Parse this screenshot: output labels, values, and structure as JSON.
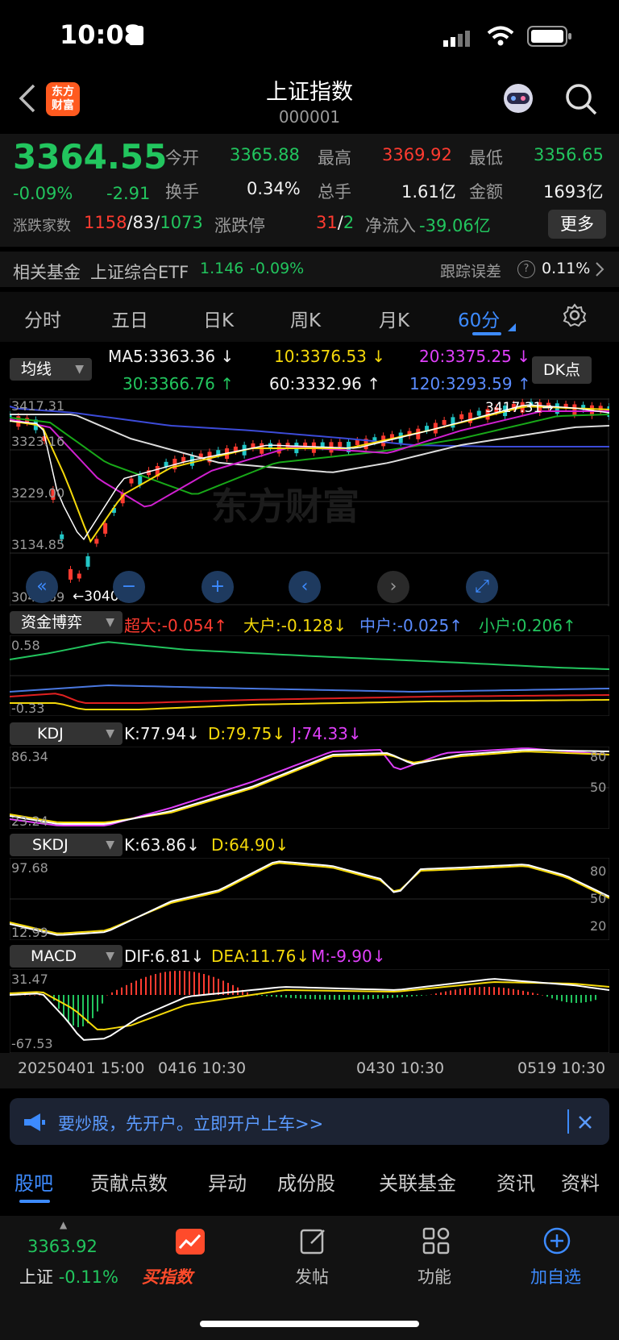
{
  "status_bar": {
    "time": "10:08"
  },
  "header": {
    "title": "上证指数",
    "code": "000001",
    "logo_text": "东方财富"
  },
  "quote": {
    "price": "3364.55",
    "change_pct": "-0.09%",
    "change": "-2.91",
    "open_label": "今开",
    "open": "3365.88",
    "high_label": "最高",
    "high": "3369.92",
    "low_label": "最低",
    "low": "3356.65",
    "turnover_label": "换手",
    "turnover": "0.34%",
    "volume_label": "总手",
    "volume": "1.61亿",
    "amount_label": "金额",
    "amount": "1693亿",
    "breadth_label": "涨跌家数",
    "up_count": "1158",
    "flat_count": "83",
    "down_count": "1073",
    "limit_label": "涨跌停",
    "limit_up": "31",
    "limit_down": "2",
    "netflow_label": "净流入",
    "netflow": "-39.06亿",
    "more_label": "更多"
  },
  "fund": {
    "label": "相关基金",
    "name": "上证综合ETF",
    "price": "1.146",
    "change": "-0.09%",
    "track_label": "跟踪误差",
    "track_value": "0.11%"
  },
  "period_tabs": [
    "分时",
    "五日",
    "日K",
    "周K",
    "月K",
    "60分"
  ],
  "period_active": "60分",
  "ma_bar": {
    "selector": "均线",
    "ma5": "MA5:3363.36",
    "ma10": "10:3376.53",
    "ma20": "20:3375.25",
    "ma30": "30:3366.76",
    "ma60": "60:3332.96",
    "ma120": "120:3293.59",
    "dk": "DK点"
  },
  "kline": {
    "y_labels": [
      "3417.31",
      "3323.16",
      "3229.00",
      "3134.85",
      "3040.69"
    ],
    "high_marker": "3417.31",
    "low_marker": "3040.69",
    "watermark": "东方财富"
  },
  "fund_flow": {
    "selector": "资金博弈",
    "super": "超大:-0.054",
    "large": "大户:-0.128",
    "medium": "中户:-0.025",
    "small": "小户:0.206",
    "y_top": "0.58",
    "y_bottom": "-0.33"
  },
  "kdj": {
    "selector": "KDJ",
    "k": "K:77.94",
    "d": "D:79.75",
    "j": "J:74.33",
    "y_top": "86.34",
    "y_bottom": "23.24",
    "r80": "80",
    "r50": "50"
  },
  "skdj": {
    "selector": "SKDJ",
    "k": "K:63.86",
    "d": "D:64.90",
    "y_top": "97.68",
    "y_bottom": "12.99",
    "r80": "80",
    "r50": "50",
    "r20": "20"
  },
  "macd": {
    "selector": "MACD",
    "dif": "DIF:6.81",
    "dea": "DEA:11.76",
    "m": "M:-9.90",
    "y_top": "31.47",
    "y_bottom": "-67.53"
  },
  "time_axis": [
    "20250401 15:00",
    "0416 10:30",
    "0430 10:30",
    "0519 10:30"
  ],
  "banner": {
    "text": "要炒股，先开户。立即开户上车>>"
  },
  "bottom_tabs": [
    "股吧",
    "贡献点数",
    "异动",
    "成份股",
    "关联基金",
    "资讯",
    "资料"
  ],
  "bottom_active": "股吧",
  "tabbar": {
    "index_price": "3363.92",
    "index_name": "上证",
    "index_change": "-0.11%",
    "buy": "买指数",
    "post": "发帖",
    "func": "功能",
    "add": "加自选"
  },
  "colors": {
    "up": "#ff3b30",
    "down": "#22c55e",
    "accent": "#3d8bff"
  }
}
